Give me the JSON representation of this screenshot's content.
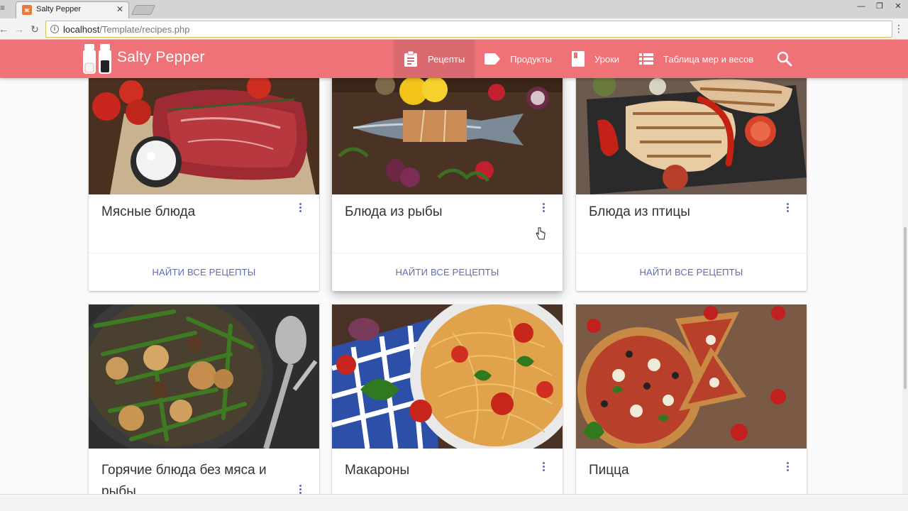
{
  "browser": {
    "tab_title": "Salty Pepper",
    "tab_favicon": "xampp-favicon",
    "url_host": "localhost",
    "url_path": "/Template/recipes.php",
    "omnibox_accent": "#d6c05a"
  },
  "site": {
    "brand": "Salty Pepper",
    "header_color": "#ee7277",
    "nav": [
      {
        "label": "Рецепты",
        "icon": "clipboard-icon",
        "active": true
      },
      {
        "label": "Продукты",
        "icon": "label-tag-icon",
        "active": false
      },
      {
        "label": "Уроки",
        "icon": "book-icon",
        "active": false
      },
      {
        "label": "Таблица мер и весов",
        "icon": "list-table-icon",
        "active": false
      }
    ],
    "search_icon": "search-icon"
  },
  "cards": [
    {
      "title": "Мясные блюда",
      "action": "НАЙТИ ВСЕ РЕЦЕПТЫ",
      "image": "raw-beef-steak-tomatoes-salt"
    },
    {
      "title": "Блюда из рыбы",
      "action": "НАЙТИ ВСЕ РЕЦЕПТЫ",
      "image": "fish-with-lemons-radishes"
    },
    {
      "title": "Блюда из птицы",
      "action": "НАЙТИ ВСЕ РЕЦЕПТЫ",
      "image": "grilled-chicken-peppers"
    },
    {
      "title": "Горячие блюда без мяса и рыбы",
      "image": "roasted-green-beans-potatoes"
    },
    {
      "title": "Макароны",
      "image": "spaghetti-tomatoes-basil"
    },
    {
      "title": "Пицца",
      "image": "pizza-slices-mushrooms"
    }
  ],
  "colors": {
    "accent": "#5c6bc0",
    "page_bg": "#fafafa"
  }
}
